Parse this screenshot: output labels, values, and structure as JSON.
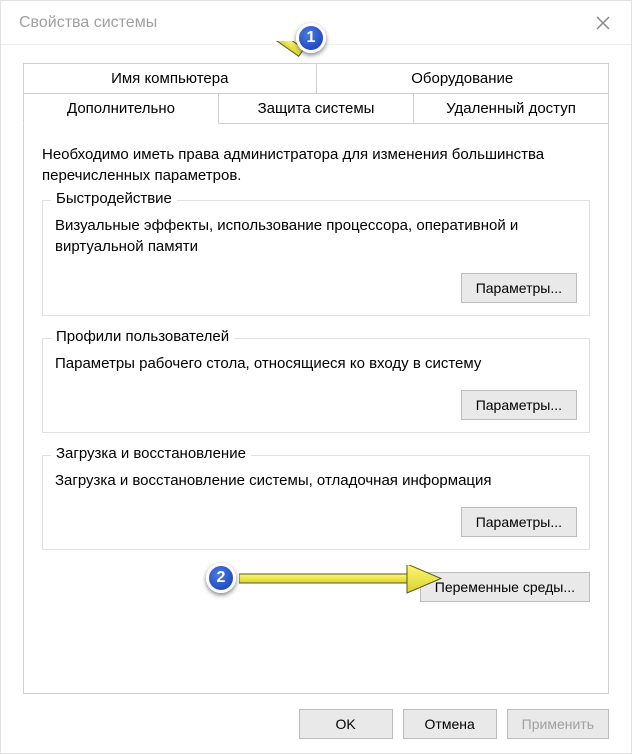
{
  "window": {
    "title": "Свойства системы"
  },
  "tabs": {
    "row1": [
      {
        "label": "Имя компьютера"
      },
      {
        "label": "Оборудование"
      }
    ],
    "row2": [
      {
        "label": "Дополнительно",
        "active": true
      },
      {
        "label": "Защита системы"
      },
      {
        "label": "Удаленный доступ"
      }
    ]
  },
  "admin_note": "Необходимо иметь права администратора для изменения большинства перечисленных параметров.",
  "groups": {
    "performance": {
      "title": "Быстродействие",
      "desc": "Визуальные эффекты, использование процессора, оперативной и виртуальной памяти",
      "button": "Параметры..."
    },
    "profiles": {
      "title": "Профили пользователей",
      "desc": "Параметры рабочего стола, относящиеся ко входу в систему",
      "button": "Параметры..."
    },
    "startup": {
      "title": "Загрузка и восстановление",
      "desc": "Загрузка и восстановление системы, отладочная информация",
      "button": "Параметры..."
    }
  },
  "env_button": "Переменные среды...",
  "dialog_buttons": {
    "ok": "OK",
    "cancel": "Отмена",
    "apply": "Применить"
  },
  "annotations": {
    "marker1": "1",
    "marker2": "2"
  }
}
